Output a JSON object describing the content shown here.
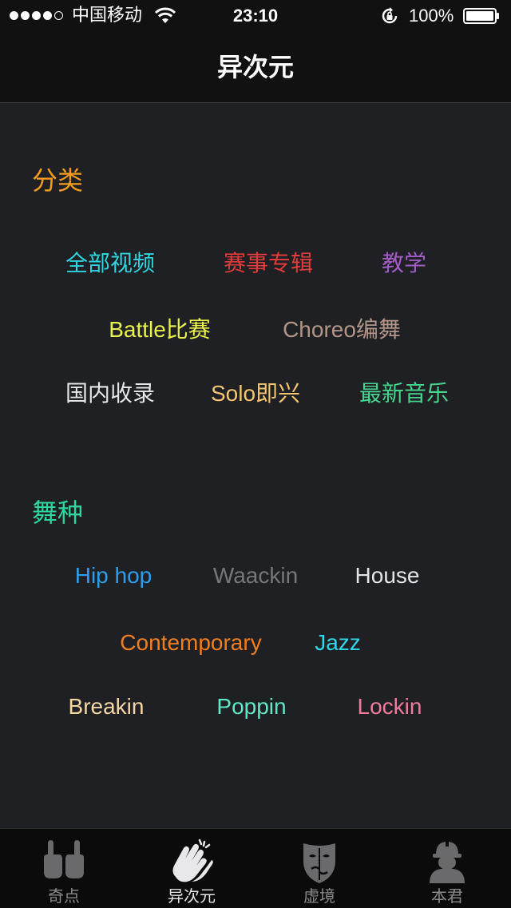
{
  "status_bar": {
    "carrier": "中国移动",
    "time": "23:10",
    "battery": "100%"
  },
  "nav": {
    "title": "异次元"
  },
  "categories": {
    "title": "分类",
    "title_color": "#f39c1f",
    "items": [
      {
        "label": "全部视频",
        "color": "#2fd6e0"
      },
      {
        "label": "赛事专辑",
        "color": "#e23b3b"
      },
      {
        "label": "教学",
        "color": "#a35bc6"
      },
      {
        "label": "Battle比赛",
        "color": "#e9f24a"
      },
      {
        "label": "Choreo编舞",
        "color": "#b19588"
      },
      {
        "label": "国内收录",
        "color": "#e6e6e6"
      },
      {
        "label": "Solo即兴",
        "color": "#f4c46f"
      },
      {
        "label": "最新音乐",
        "color": "#47d68f"
      }
    ]
  },
  "dance_styles": {
    "title": "舞种",
    "title_color": "#2fd4a0",
    "items": [
      {
        "label": "Hip hop",
        "color": "#2f9de8"
      },
      {
        "label": "Waackin",
        "color": "#77777a"
      },
      {
        "label": "House",
        "color": "#e4e4e4"
      },
      {
        "label": "Contemporary",
        "color": "#f07f22"
      },
      {
        "label": "Jazz",
        "color": "#2fd6e8"
      },
      {
        "label": "Breakin",
        "color": "#f4d6a2"
      },
      {
        "label": "Poppin",
        "color": "#5fe8c6"
      },
      {
        "label": "Lockin",
        "color": "#ee7b9c"
      }
    ]
  },
  "tabs": [
    {
      "label": "奇点",
      "icon": "hands-pointing-icon",
      "active": false
    },
    {
      "label": "异次元",
      "icon": "clapping-hands-icon",
      "active": true
    },
    {
      "label": "虚境",
      "icon": "mask-icon",
      "active": false
    },
    {
      "label": "本君",
      "icon": "worker-profile-icon",
      "active": false
    }
  ]
}
